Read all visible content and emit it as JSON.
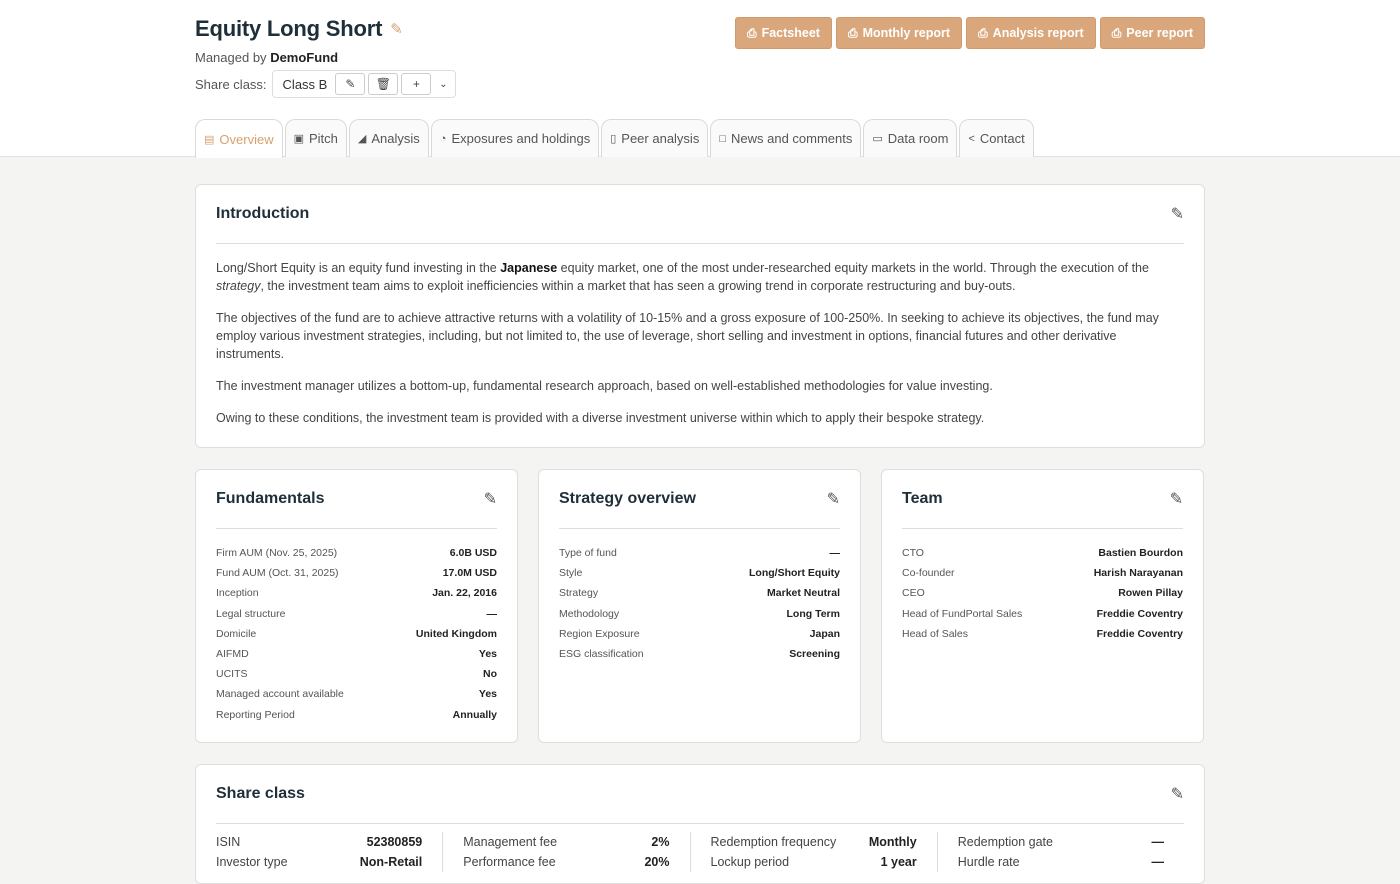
{
  "header": {
    "title": "Equity Long Short",
    "managed_prefix": "Managed by",
    "manager": "DemoFund",
    "share_class_label": "Share class:",
    "share_class_value": "Class B"
  },
  "actions": [
    "Factsheet",
    "Monthly report",
    "Analysis report",
    "Peer report"
  ],
  "tabs": [
    {
      "label": "Overview",
      "icon": "card-icon"
    },
    {
      "label": "Pitch",
      "icon": "book-icon"
    },
    {
      "label": "Analysis",
      "icon": "chart-icon"
    },
    {
      "label": "Exposures and holdings",
      "icon": "pie-icon"
    },
    {
      "label": "Peer analysis",
      "icon": "bar-icon"
    },
    {
      "label": "News and comments",
      "icon": "comment-icon"
    },
    {
      "label": "Data room",
      "icon": "folder-icon"
    },
    {
      "label": "Contact",
      "icon": "share-icon"
    }
  ],
  "introduction": {
    "title": "Introduction",
    "p1_a": "Long/Short Equity is an equity fund investing in the ",
    "p1_b": "Japanese",
    "p1_c": " equity market, one of the most under-researched equity markets in the world. Through the execution of the ",
    "p1_d": "strategy",
    "p1_e": ", the investment team aims to exploit inefficiencies within a market that has seen a growing trend in corporate restructuring and buy-outs.",
    "p2": "The objectives of the fund are to achieve attractive returns with a volatility of 10-15% and a gross exposure of 100-250%. In seeking to achieve its objectives, the fund may employ various investment strategies, including, but not limited to, the use of leverage, short selling and investment in options, financial futures and other derivative instruments.",
    "p3": "The investment manager utilizes a bottom-up, fundamental research approach, based on well-established methodologies for value investing.",
    "p4": "Owing to these conditions, the investment team is provided with a diverse investment universe within which to apply their bespoke strategy."
  },
  "fundamentals": {
    "title": "Fundamentals",
    "rows": [
      {
        "k": "Firm AUM (Nov. 25, 2025)",
        "v": "6.0B USD"
      },
      {
        "k": "Fund AUM (Oct. 31, 2025)",
        "v": "17.0M USD"
      },
      {
        "k": "Inception",
        "v": "Jan. 22, 2016"
      },
      {
        "k": "Legal structure",
        "v": "—"
      },
      {
        "k": "Domicile",
        "v": "United Kingdom"
      },
      {
        "k": "AIFMD",
        "v": "Yes"
      },
      {
        "k": "UCITS",
        "v": "No"
      },
      {
        "k": "Managed account available",
        "v": "Yes"
      },
      {
        "k": "Reporting Period",
        "v": "Annually"
      }
    ]
  },
  "strategy": {
    "title": "Strategy overview",
    "rows": [
      {
        "k": "Type of fund",
        "v": "—"
      },
      {
        "k": "Style",
        "v": "Long/Short Equity"
      },
      {
        "k": "Strategy",
        "v": "Market Neutral"
      },
      {
        "k": "Methodology",
        "v": "Long Term"
      },
      {
        "k": "Region Exposure",
        "v": "Japan"
      },
      {
        "k": "ESG classification",
        "v": "Screening"
      }
    ]
  },
  "team": {
    "title": "Team",
    "rows": [
      {
        "k": "CTO",
        "v": "Bastien Bourdon"
      },
      {
        "k": "Co-founder",
        "v": "Harish Narayanan"
      },
      {
        "k": "CEO",
        "v": "Rowen Pillay"
      },
      {
        "k": "Head of FundPortal Sales",
        "v": "Freddie Coventry"
      },
      {
        "k": "Head of Sales",
        "v": "Freddie Coventry"
      }
    ]
  },
  "share_class": {
    "title": "Share class",
    "cols": [
      [
        {
          "k": "ISIN",
          "v": "52380859"
        },
        {
          "k": "Investor type",
          "v": "Non-Retail"
        }
      ],
      [
        {
          "k": "Management fee",
          "v": "2%"
        },
        {
          "k": "Performance fee",
          "v": "20%"
        }
      ],
      [
        {
          "k": "Redemption frequency",
          "v": "Monthly"
        },
        {
          "k": "Lockup period",
          "v": "1 year"
        }
      ],
      [
        {
          "k": "Redemption gate",
          "v": "—"
        },
        {
          "k": "Hurdle rate",
          "v": "—"
        }
      ]
    ]
  },
  "colors": {
    "accent": "#d9a77b",
    "title": "#1f2f3a"
  }
}
